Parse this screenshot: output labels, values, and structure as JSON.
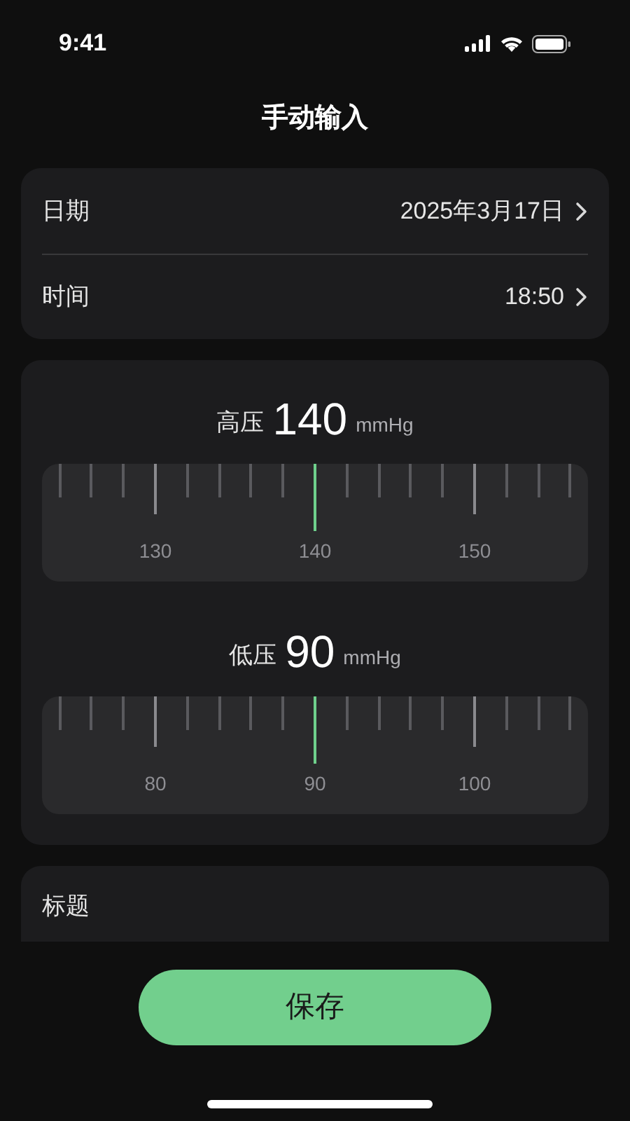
{
  "status_bar": {
    "time": "9:41"
  },
  "title": "手动输入",
  "datetime_rows": [
    {
      "label": "日期",
      "value": "2025年3月17日"
    },
    {
      "label": "时间",
      "value": "18:50"
    }
  ],
  "pickers": [
    {
      "label": "高压",
      "value": "140",
      "unit": "mmHg",
      "tick_labels": [
        "130",
        "140",
        "150"
      ]
    },
    {
      "label": "低压",
      "value": "90",
      "unit": "mmHg",
      "tick_labels": [
        "80",
        "90",
        "100"
      ]
    }
  ],
  "title_field": {
    "label": "标题"
  },
  "save_button": "保存"
}
